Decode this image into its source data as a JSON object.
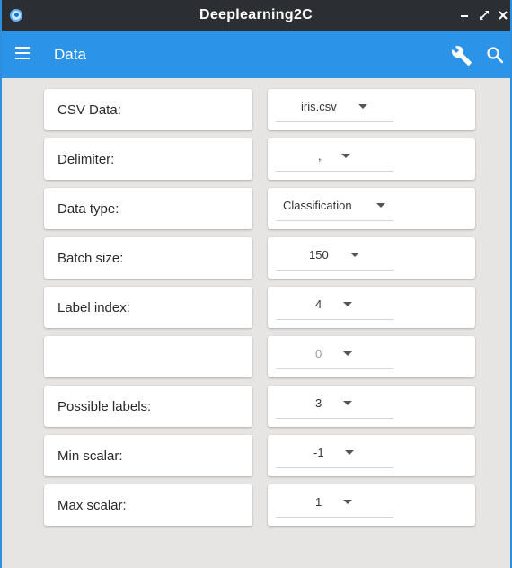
{
  "window": {
    "title": "Deeplearning2C"
  },
  "appbar": {
    "title": "Data"
  },
  "rows": [
    {
      "label": "CSV Data:",
      "value": "iris.csv"
    },
    {
      "label": "Delimiter:",
      "value": ","
    },
    {
      "label": "Data type:",
      "value": "Classification"
    },
    {
      "label": "Batch size:",
      "value": "150"
    },
    {
      "label": "Label index:",
      "value": "4"
    },
    {
      "label": "",
      "value": "0",
      "disabled": true
    },
    {
      "label": "Possible labels:",
      "value": "3"
    },
    {
      "label": "Min scalar:",
      "value": "-1"
    },
    {
      "label": "Max scalar:",
      "value": "1"
    }
  ]
}
